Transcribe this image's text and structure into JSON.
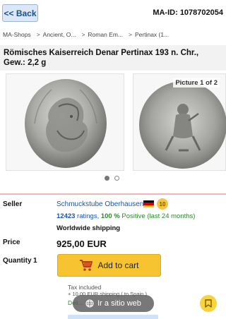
{
  "header": {
    "back_label": "<< Back",
    "ma_id": "MA-ID: 1078702054"
  },
  "breadcrumb": [
    "MA-Shops",
    "Ancient, O...",
    "Roman Em...",
    "Pertinax (1..."
  ],
  "item": {
    "title": "Römisches Kaiserreich Denar Pertinax 193 n. Chr., Gew.: 2,2 g"
  },
  "gallery": {
    "counter": "Picture 1 of 2",
    "active_index": 0,
    "total": 2
  },
  "seller": {
    "label": "Seller",
    "name": "Schmuckstube Oberhausen",
    "badge": "10",
    "ratings_count": "12423",
    "ratings_word": " ratings, ",
    "positive_pct": "100 %",
    "positive_text": " Positive (last 24 months)",
    "shipping": "Worldwide shipping"
  },
  "price": {
    "label": "Price",
    "value": "925,00 EUR"
  },
  "quantity": {
    "label": "Quantity",
    "value": "1"
  },
  "cart": {
    "label": "Add to cart"
  },
  "notes": {
    "tax": "Tax included",
    "shipping_link": "+ 10,00 EUR shipping ( to Spain )",
    "delivery": "Deli..."
  },
  "overlay": {
    "web_label": "Ir a sitio web"
  },
  "colors": {
    "accent_yellow": "#f7c431",
    "link_blue": "#1a55b0",
    "positive_green": "#2a8a2a",
    "divider_pink": "#f2b6b6"
  },
  "icons": {
    "cart": "cart-icon",
    "globe": "globe-icon",
    "fab": "bookmark-icon"
  }
}
